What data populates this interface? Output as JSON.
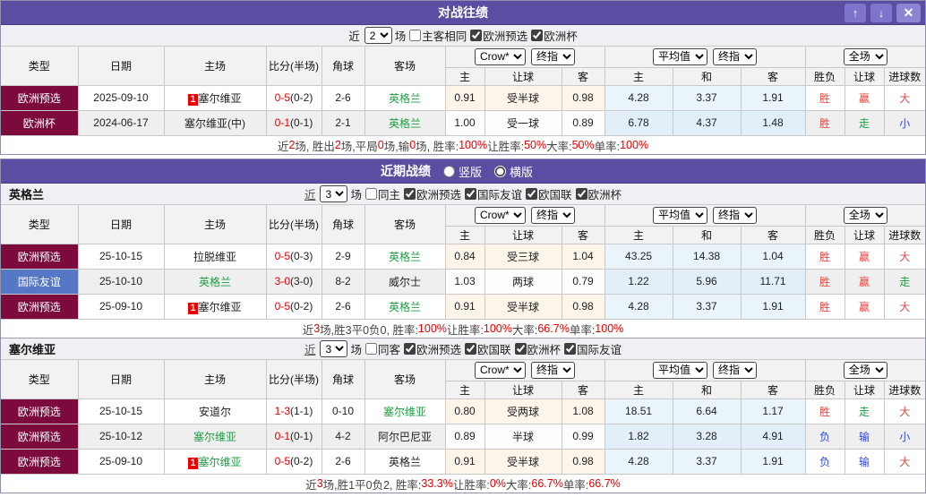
{
  "colors": {
    "accent_purple": "#5a4da2",
    "type_maroon": "#7d0a3c",
    "type_blue": "#5577c4",
    "score_red": "#e60000",
    "win_red": "#e8463f",
    "draw_green": "#1f9e43",
    "lose_blue": "#2f4bd7",
    "avg_bg": "#e9f4fb",
    "odds_bg": "#fdf5ea"
  },
  "table_header": {
    "left_cols": [
      "类型",
      "日期",
      "主场",
      "比分(半场)",
      "角球",
      "客场"
    ],
    "sub_cols": [
      "主",
      "让球",
      "客",
      "主",
      "和",
      "客",
      "胜负",
      "让球",
      "进球数"
    ],
    "dropdown_groups": [
      [
        "Crow*",
        "终指"
      ],
      [
        "平均值",
        "终指"
      ],
      [
        "全场"
      ]
    ],
    "dropdown_names": [
      [
        "bookmaker-select",
        "stage-select"
      ],
      [
        "average-select",
        "stage-select"
      ],
      [
        "scope-select"
      ]
    ]
  },
  "sections": [
    {
      "title": "对战往绩",
      "window_buttons": [
        "↑",
        "↓",
        "✕"
      ],
      "filter": {
        "near": "近",
        "count": "2",
        "unit": "场",
        "checks": [
          {
            "label": "主客相同",
            "checked": false
          },
          {
            "label": "欧洲预选",
            "checked": true
          },
          {
            "label": "欧洲杯",
            "checked": true
          }
        ]
      },
      "rows": [
        {
          "type": "欧洲预选",
          "type_color": "maroon",
          "date": "2025-09-10",
          "home": {
            "name": "塞尔维亚",
            "green": false,
            "badge": "1"
          },
          "score": {
            "ft": "0-5",
            "ht": "(0-2)"
          },
          "corner": "2-6",
          "away": {
            "name": "英格兰",
            "green": true
          },
          "odds": [
            "0.91",
            "受半球",
            "0.98"
          ],
          "avg": [
            "4.28",
            "3.37",
            "1.91"
          ],
          "results": [
            {
              "t": "胜",
              "c": "red"
            },
            {
              "t": "赢",
              "c": "red"
            },
            {
              "t": "大",
              "c": "red"
            }
          ]
        },
        {
          "type": "欧洲杯",
          "type_color": "maroon",
          "date": "2024-06-17",
          "home": {
            "name": "塞尔维亚(中)",
            "green": false
          },
          "score": {
            "ft": "0-1",
            "ht": "(0-1)"
          },
          "corner": "2-1",
          "away": {
            "name": "英格兰",
            "green": true
          },
          "odds": [
            "1.00",
            "受一球",
            "0.89"
          ],
          "avg": [
            "6.78",
            "4.37",
            "1.48"
          ],
          "results": [
            {
              "t": "胜",
              "c": "red"
            },
            {
              "t": "走",
              "c": "green"
            },
            {
              "t": "小",
              "c": "blue"
            }
          ]
        }
      ],
      "summary": [
        {
          "t": "近 "
        },
        {
          "t": "2",
          "r": true
        },
        {
          "t": " 场, 胜出 "
        },
        {
          "t": "2",
          "r": true
        },
        {
          "t": " 场,平局 "
        },
        {
          "t": "0",
          "r": true
        },
        {
          "t": " 场,输 "
        },
        {
          "t": "0",
          "r": true
        },
        {
          "t": " 场, 胜率: "
        },
        {
          "t": "100%",
          "r": true
        },
        {
          "t": " 让胜率: "
        },
        {
          "t": "50%",
          "r": true
        },
        {
          "t": " 大率: "
        },
        {
          "t": "50%",
          "r": true
        },
        {
          "t": " 单率: "
        },
        {
          "t": "100%",
          "r": true
        }
      ]
    },
    {
      "title": "近期战绩",
      "radios": [
        {
          "label": "竖版",
          "checked": false
        },
        {
          "label": "横版",
          "checked": true
        }
      ],
      "team": "英格兰",
      "filter": {
        "near": "近",
        "count": "3",
        "unit": "场",
        "checks": [
          {
            "label": "同主",
            "checked": false
          },
          {
            "label": "欧洲预选",
            "checked": true
          },
          {
            "label": "国际友谊",
            "checked": true
          },
          {
            "label": "欧国联",
            "checked": true
          },
          {
            "label": "欧洲杯",
            "checked": true
          }
        ]
      },
      "rows": [
        {
          "type": "欧洲预选",
          "type_color": "maroon",
          "date": "25-10-15",
          "home": {
            "name": "拉脱维亚",
            "green": false
          },
          "score": {
            "ft": "0-5",
            "ht": "(0-3)"
          },
          "corner": "2-9",
          "away": {
            "name": "英格兰",
            "green": true
          },
          "odds": [
            "0.84",
            "受三球",
            "1.04"
          ],
          "avg": [
            "43.25",
            "14.38",
            "1.04"
          ],
          "results": [
            {
              "t": "胜",
              "c": "red"
            },
            {
              "t": "赢",
              "c": "red"
            },
            {
              "t": "大",
              "c": "red"
            }
          ]
        },
        {
          "type": "国际友谊",
          "type_color": "blue",
          "date": "25-10-10",
          "home": {
            "name": "英格兰",
            "green": true
          },
          "score": {
            "ft": "3-0",
            "ht": "(3-0)"
          },
          "corner": "8-2",
          "away": {
            "name": "威尔士",
            "green": false
          },
          "odds": [
            "1.03",
            "两球",
            "0.79"
          ],
          "avg": [
            "1.22",
            "5.96",
            "11.71"
          ],
          "results": [
            {
              "t": "胜",
              "c": "red"
            },
            {
              "t": "赢",
              "c": "red"
            },
            {
              "t": "走",
              "c": "green"
            }
          ]
        },
        {
          "type": "欧洲预选",
          "type_color": "maroon",
          "date": "25-09-10",
          "home": {
            "name": "塞尔维亚",
            "green": false,
            "badge": "1"
          },
          "score": {
            "ft": "0-5",
            "ht": "(0-2)"
          },
          "corner": "2-6",
          "away": {
            "name": "英格兰",
            "green": true
          },
          "odds": [
            "0.91",
            "受半球",
            "0.98"
          ],
          "avg": [
            "4.28",
            "3.37",
            "1.91"
          ],
          "results": [
            {
              "t": "胜",
              "c": "red"
            },
            {
              "t": "赢",
              "c": "red"
            },
            {
              "t": "大",
              "c": "red"
            }
          ]
        }
      ],
      "summary": [
        {
          "t": "近"
        },
        {
          "t": "3",
          "r": true
        },
        {
          "t": "场,胜3平0负0, 胜率:"
        },
        {
          "t": "100%",
          "r": true
        },
        {
          "t": " 让胜率:"
        },
        {
          "t": "100%",
          "r": true
        },
        {
          "t": " 大率:"
        },
        {
          "t": "66.7%",
          "r": true
        },
        {
          "t": " 单率:"
        },
        {
          "t": "100%",
          "r": true
        }
      ]
    },
    {
      "team": "塞尔维亚",
      "filter": {
        "near": "近",
        "count": "3",
        "unit": "场",
        "checks": [
          {
            "label": "同客",
            "checked": false
          },
          {
            "label": "欧洲预选",
            "checked": true
          },
          {
            "label": "欧国联",
            "checked": true
          },
          {
            "label": "欧洲杯",
            "checked": true
          },
          {
            "label": "国际友谊",
            "checked": true
          }
        ]
      },
      "rows": [
        {
          "type": "欧洲预选",
          "type_color": "maroon",
          "date": "25-10-15",
          "home": {
            "name": "安道尔",
            "green": false
          },
          "score": {
            "ft": "1-3",
            "ht": "(1-1)"
          },
          "corner": "0-10",
          "away": {
            "name": "塞尔维亚",
            "green": true
          },
          "odds": [
            "0.80",
            "受两球",
            "1.08"
          ],
          "avg": [
            "18.51",
            "6.64",
            "1.17"
          ],
          "results": [
            {
              "t": "胜",
              "c": "red"
            },
            {
              "t": "走",
              "c": "green"
            },
            {
              "t": "大",
              "c": "red"
            }
          ]
        },
        {
          "type": "欧洲预选",
          "type_color": "maroon",
          "date": "25-10-12",
          "home": {
            "name": "塞尔维亚",
            "green": true
          },
          "score": {
            "ft": "0-1",
            "ht": "(0-1)"
          },
          "corner": "4-2",
          "away": {
            "name": "阿尔巴尼亚",
            "green": false
          },
          "odds": [
            "0.89",
            "半球",
            "0.99"
          ],
          "avg": [
            "1.82",
            "3.28",
            "4.91"
          ],
          "results": [
            {
              "t": "负",
              "c": "blue"
            },
            {
              "t": "输",
              "c": "blue"
            },
            {
              "t": "小",
              "c": "blue"
            }
          ]
        },
        {
          "type": "欧洲预选",
          "type_color": "maroon",
          "date": "25-09-10",
          "home": {
            "name": "塞尔维亚",
            "green": true,
            "badge": "1"
          },
          "score": {
            "ft": "0-5",
            "ht": "(0-2)"
          },
          "corner": "2-6",
          "away": {
            "name": "英格兰",
            "green": false
          },
          "odds": [
            "0.91",
            "受半球",
            "0.98"
          ],
          "avg": [
            "4.28",
            "3.37",
            "1.91"
          ],
          "results": [
            {
              "t": "负",
              "c": "blue"
            },
            {
              "t": "输",
              "c": "blue"
            },
            {
              "t": "大",
              "c": "red"
            }
          ]
        }
      ],
      "summary": [
        {
          "t": "近"
        },
        {
          "t": "3",
          "r": true
        },
        {
          "t": "场,胜1平0负2, 胜率:"
        },
        {
          "t": "33.3%",
          "r": true
        },
        {
          "t": " 让胜率:"
        },
        {
          "t": "0%",
          "r": true
        },
        {
          "t": " 大率:"
        },
        {
          "t": "66.7%",
          "r": true
        },
        {
          "t": " 单率:"
        },
        {
          "t": "66.7%",
          "r": true
        }
      ]
    }
  ]
}
